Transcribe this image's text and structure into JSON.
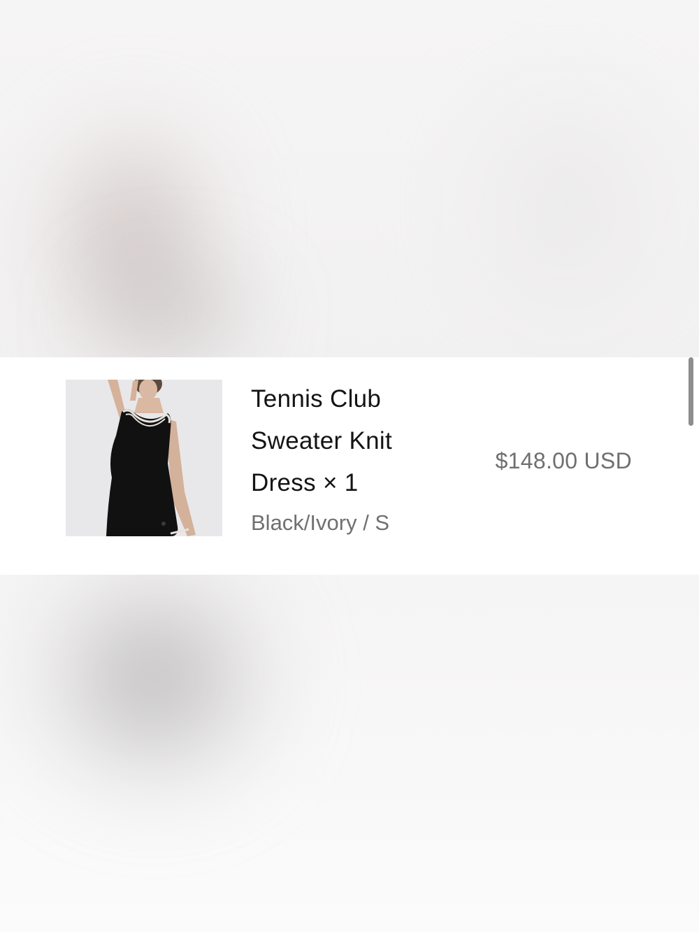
{
  "line_item": {
    "title": "Tennis Club Sweater Knit Dress",
    "quantity_text": "× 1",
    "variant": "Black/Ivory / S",
    "price": "$148.00 USD",
    "image_icon": "product-photo-black-dress"
  },
  "colors": {
    "card_background": "#ffffff",
    "title_text": "#141414",
    "secondary_text": "#707070",
    "backdrop": "#f4f3f3"
  }
}
